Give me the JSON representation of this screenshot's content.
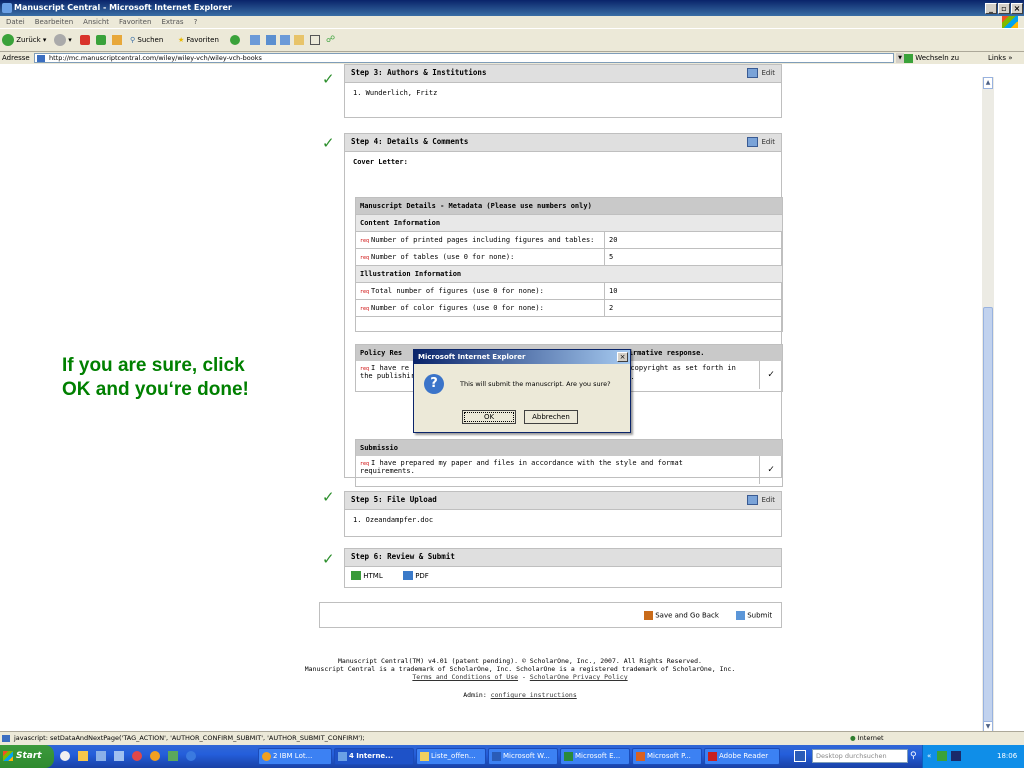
{
  "window": {
    "title": "Manuscript Central - Microsoft Internet Explorer"
  },
  "menu": [
    "Datei",
    "Bearbeiten",
    "Ansicht",
    "Favoriten",
    "Extras",
    "?"
  ],
  "toolbar": {
    "back": "Zurück",
    "search": "Suchen",
    "favorites": "Favoriten"
  },
  "address": {
    "label": "Adresse",
    "url": "http://mc.manuscriptcentral.com/wiley/wiley-vch/wiley-vch-books",
    "go": "Wechseln zu",
    "links": "Links"
  },
  "steps": {
    "step3": {
      "title": "Step 3: Authors & Institutions",
      "edit": "Edit",
      "items": [
        "1.  Wunderlich, Fritz"
      ]
    },
    "step4": {
      "title": "Step 4: Details & Comments",
      "edit": "Edit",
      "cover_letter": "Cover Letter:",
      "metadata_title": "Manuscript Details - Metadata (Please use numbers only)",
      "content_info": "Content Information",
      "illustration_info": "Illustration Information",
      "rows": [
        {
          "label": "Number of printed pages including figures and tables:",
          "value": "20"
        },
        {
          "label": "Number of tables (use 0 for none):",
          "value": "5"
        },
        {
          "label": "Total number of figures (use 0 for none):",
          "value": "10"
        },
        {
          "label": "Number of color figures (use 0 for none):",
          "value": "2"
        }
      ],
      "req": "req",
      "policy_title_left": "Policy Res",
      "policy_title_right": "affirmative response.",
      "policy_text_left": "I have re",
      "policy_text_left2": "the publishir",
      "policy_text_right": "f copyright as set forth in",
      "policy_text_right2": "e).",
      "submission_title": "Submissio",
      "submission_text": "I have prepared my paper and files in accordance with the style and format",
      "submission_text2": "requirements.",
      "check": "✓"
    },
    "step5": {
      "title": "Step 5: File Upload",
      "edit": "Edit",
      "items": [
        "1.  Ozeandampfer.doc"
      ]
    },
    "step6": {
      "title": "Step 6: Review & Submit",
      "html": "HTML",
      "pdf": "PDF"
    }
  },
  "actions": {
    "save": "Save and Go Back",
    "submit": "Submit"
  },
  "footer": {
    "line1": "Manuscript Central(TM) v4.01 (patent pending). © ScholarOne, Inc., 2007. All Rights Reserved.",
    "line2": "Manuscript Central is a trademark of ScholarOne, Inc. ScholarOne is a registered trademark of ScholarOne, Inc.",
    "terms": "Terms and Conditions of Use",
    "sep": " - ",
    "privacy": "ScholarOne Privacy Policy",
    "admin_label": "Admin:",
    "admin_link": "configure instructions"
  },
  "dialog": {
    "title": "Microsoft Internet Explorer",
    "message": "This will submit the manuscript. Are you sure?",
    "ok": "OK",
    "cancel": "Abbrechen"
  },
  "annotation": {
    "line1": "If you are sure, click",
    "line2": "OK and you‘re done!"
  },
  "status": {
    "text": "javascript: setDataAndNextPage('TAG_ACTION', 'AUTHOR_CONFIRM_SUBMIT', 'AUTHOR_SUBMIT_CONFIRM');",
    "zone": "Internet"
  },
  "taskbar": {
    "start": "Start",
    "tasks": [
      "2 IBM Lot...",
      "4 Interne...",
      "Liste_offen...",
      "Microsoft W...",
      "Microsoft E...",
      "Microsoft P...",
      "Adobe Reader"
    ],
    "desktop_search": "Desktop durchsuchen",
    "clock": "18:06"
  },
  "colors": {
    "accent_green": "#008000",
    "titlebar": "#0a246a",
    "taskbar": "#245edb"
  }
}
